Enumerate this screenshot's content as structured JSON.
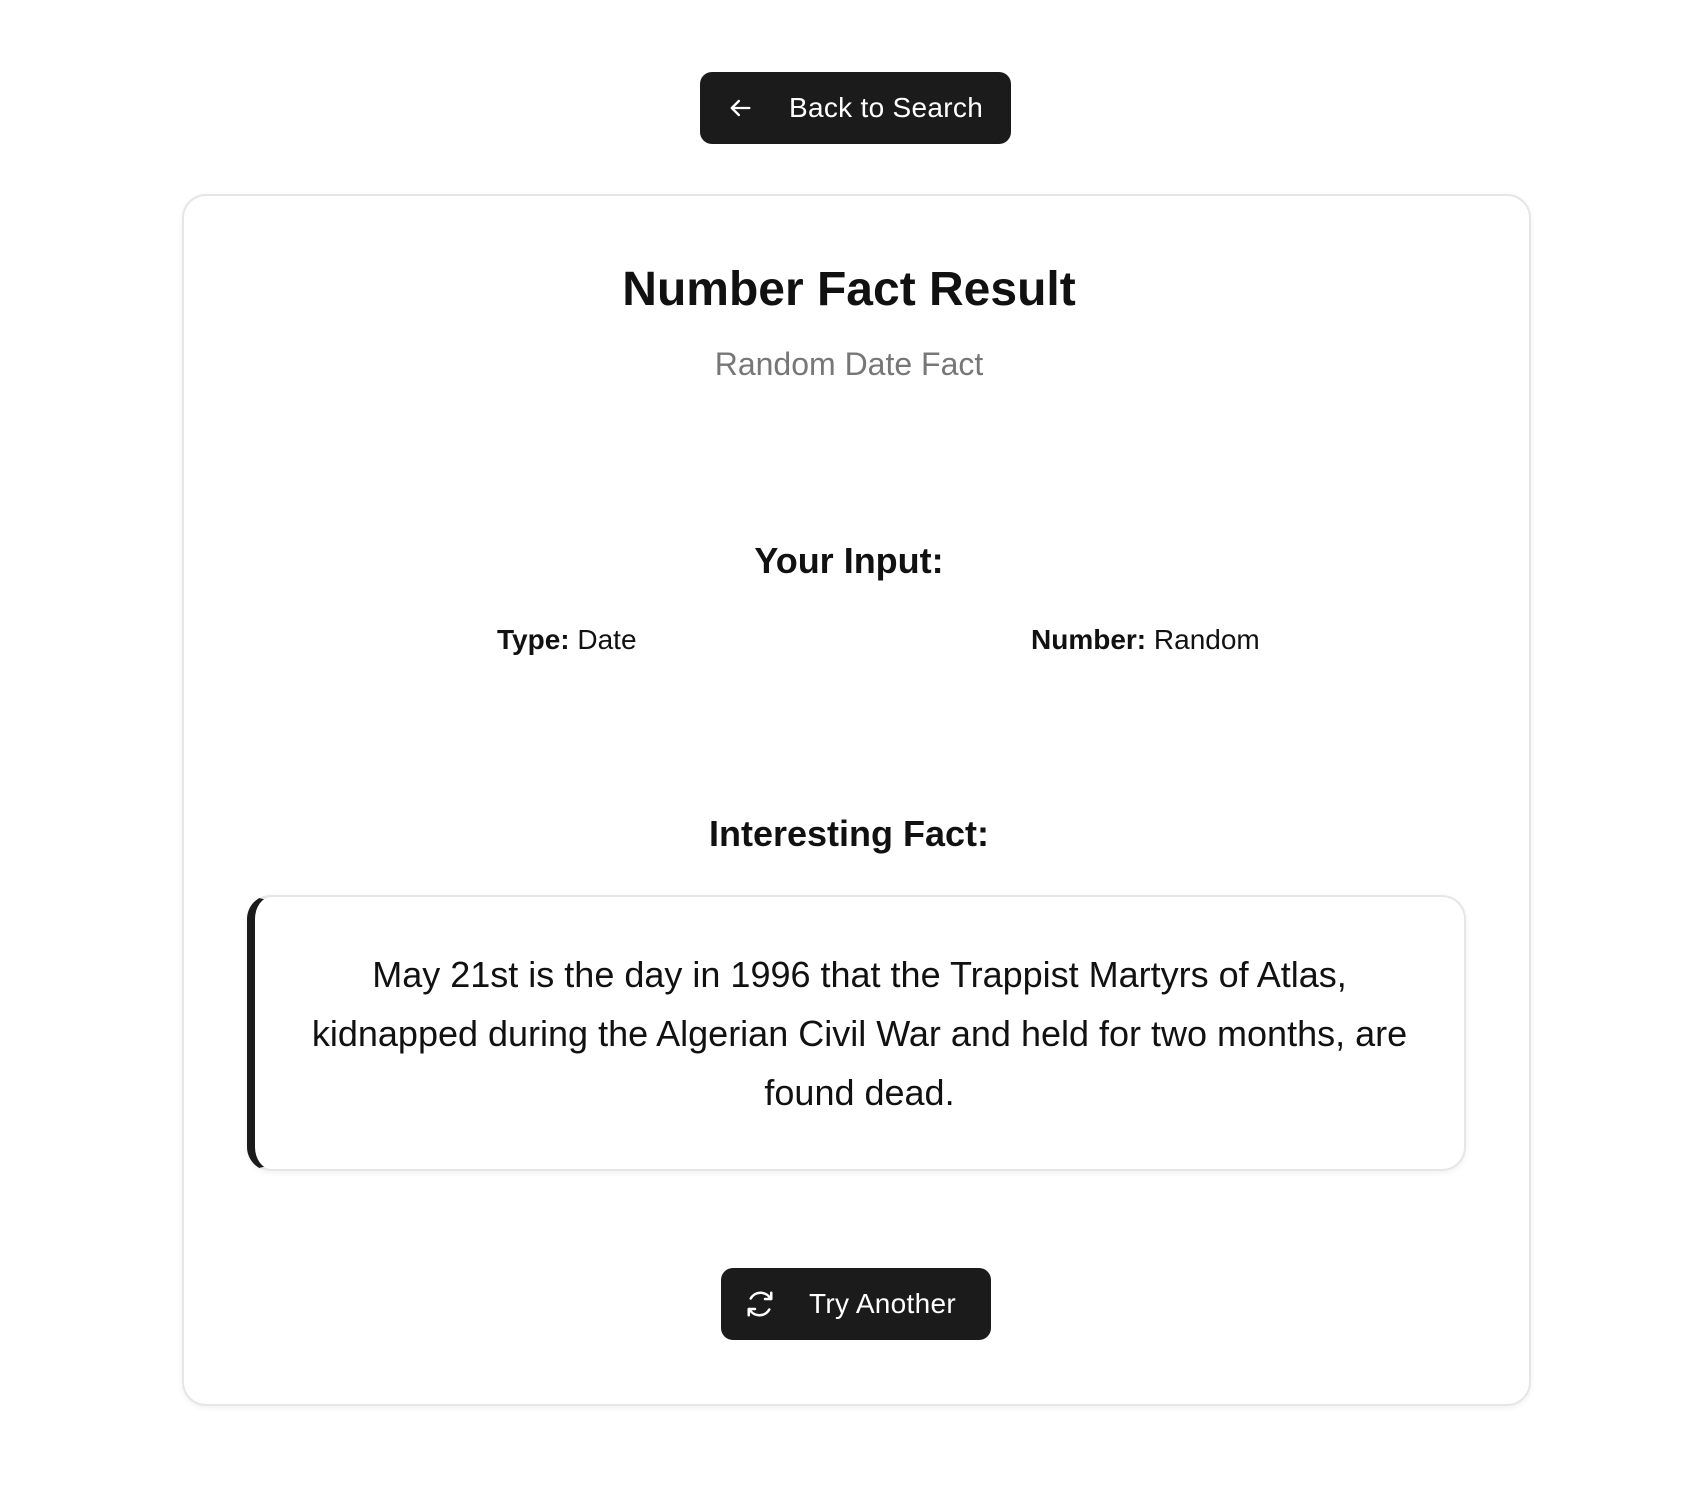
{
  "nav": {
    "back_label": "Back to Search",
    "back_icon": "arrow-left-icon"
  },
  "card": {
    "title": "Number Fact Result",
    "subtitle": "Random Date Fact",
    "input_section": {
      "heading": "Your Input:",
      "type_key": "Type:",
      "type_value": "Date",
      "number_key": "Number:",
      "number_value": "Random"
    },
    "fact_section": {
      "heading": "Interesting Fact:",
      "text": "May 21st is the day in 1996 that the Trappist Martyrs of Atlas, kidnapped during the Algerian Civil War and held for two months, are found dead."
    },
    "try_label": "Try Another",
    "try_icon": "refresh-icon"
  },
  "colors": {
    "button_bg": "#1b1b1b",
    "subtitle": "#777777",
    "border": "#e6e6e6"
  }
}
